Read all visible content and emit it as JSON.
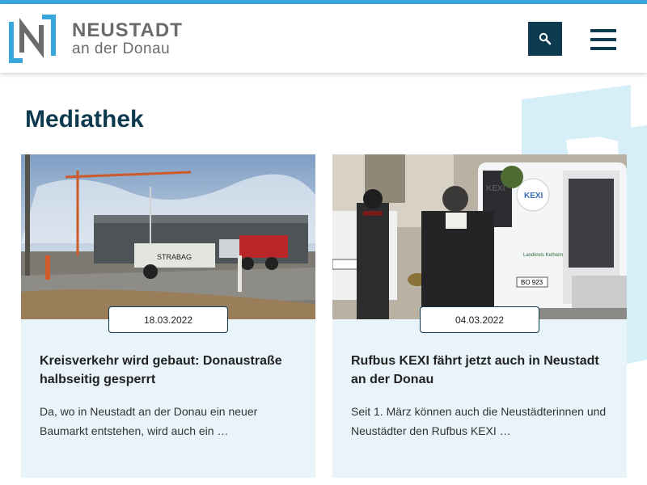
{
  "header": {
    "brand_name": "NEUSTADT",
    "brand_sub": "an der Donau",
    "icons": {
      "logo": "neustadt-n-logo",
      "search": "search-icon",
      "menu": "hamburger-menu-icon"
    }
  },
  "colors": {
    "accent": "#3aa7dc",
    "dark": "#0d3a4f",
    "card_bg": "#e8f4fa"
  },
  "main": {
    "title": "Mediathek",
    "cards": [
      {
        "date": "18.03.2022",
        "title": "Kreisverkehr wird gebaut: Donaustraße halbseitig gesperrt",
        "text": "Da, wo in Neustadt an der Donau ein neuer Baumarkt entstehen, wird auch ein …",
        "image": "construction-site-photo",
        "image_text": {
          "truck": "STRABAG"
        }
      },
      {
        "date": "04.03.2022",
        "title": "Rufbus KEXI fährt jetzt auch in Neustadt an der Donau",
        "text": "Seit 1. März können auch die Neustädterinnen und Neustädter den Rufbus KEXI …",
        "image": "kexi-bus-blessing-photo",
        "image_text": {
          "van": "KEXI",
          "window": "KEXI",
          "plate": "BO 923",
          "logo": "Landkreis Kelheim"
        }
      }
    ]
  }
}
